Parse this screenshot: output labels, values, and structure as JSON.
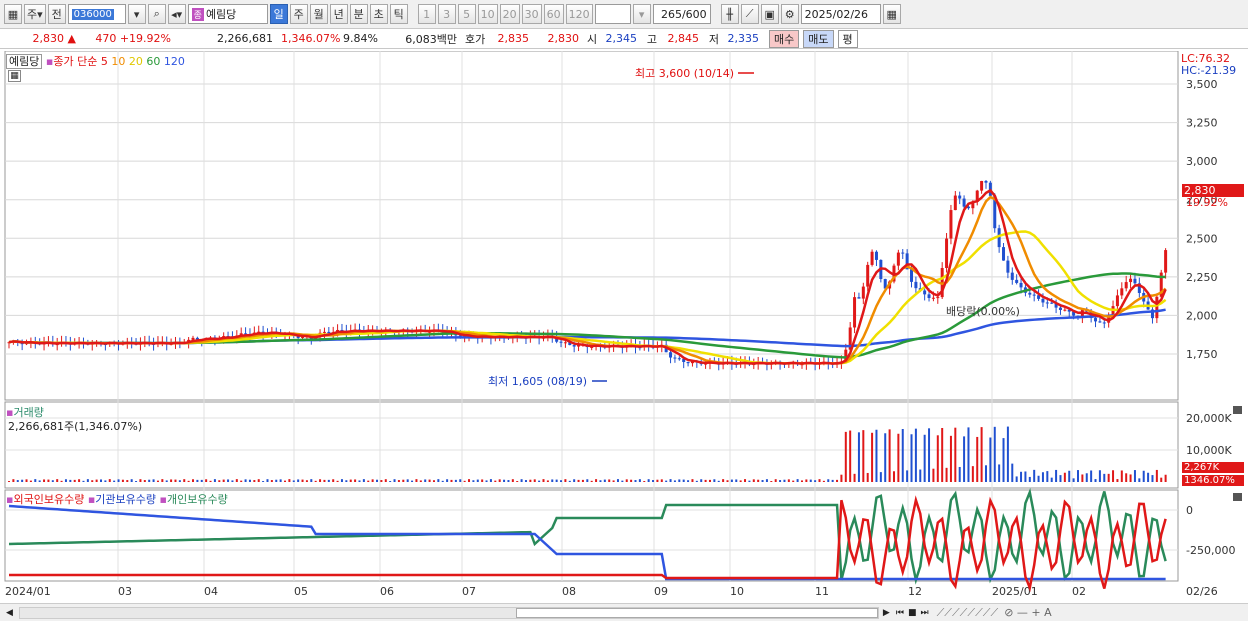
{
  "toolbar": {
    "market": "주",
    "prev": "전",
    "code": "036000",
    "stock_name": "예림당",
    "stock_badge": "종",
    "periods": [
      "일",
      "주",
      "월",
      "년",
      "분",
      "초",
      "틱"
    ],
    "intervals": [
      "1",
      "3",
      "5",
      "10",
      "20",
      "30",
      "60",
      "120"
    ],
    "count": "265",
    "count_total": "/600",
    "date": "2025/02/26"
  },
  "quote": {
    "price": "2,830",
    "arrow": "▲",
    "change": "470",
    "change_pct": "+19.92%",
    "volume": "2,266,681",
    "vol_pct": "1,346.07%",
    "turnover": "9.84%",
    "amount": "6,083백만",
    "ask_label": "호가",
    "ask1": "2,835",
    "ask2": "2,830",
    "open_label": "시",
    "open": "2,345",
    "high_label": "고",
    "high": "2,845",
    "low_label": "저",
    "low": "2,335",
    "buy": "매수",
    "sell": "매도",
    "eval": "평"
  },
  "main_panel": {
    "legend_name": "예림당",
    "legend_series": "종가 단순",
    "ma_periods": [
      "5",
      "10",
      "20",
      "60",
      "120"
    ],
    "lc": "LC:76.32",
    "hc": "HC:-21.39",
    "price_tag": "2,830",
    "pct_tag": "19.92%",
    "high_note": "최고 3,600 (10/14)",
    "low_note": "최저 1,605 (08/19)",
    "dividend_note": "배당락(0.00%)",
    "y_ticks": [
      "3,500",
      "3,250",
      "3,000",
      "2,750",
      "2,500",
      "2,250",
      "2,000",
      "1,750"
    ]
  },
  "volume_panel": {
    "title": "거래량",
    "value": "2,266,681주(1,346.07%)",
    "y_ticks": [
      "20,000K",
      "10,000K"
    ],
    "tag1": "2,267K",
    "tag2": "1346.07%"
  },
  "holder_panel": {
    "series": [
      "외국인보유수량",
      "기관보유수량",
      "개인보유수량"
    ],
    "y_ticks": [
      "0",
      "-250,000"
    ]
  },
  "x_axis": {
    "labels": [
      "2024/01",
      "03",
      "04",
      "05",
      "06",
      "07",
      "08",
      "09",
      "10",
      "11",
      "12",
      "2025/01",
      "02",
      "02/26"
    ]
  },
  "colors": {
    "ma5": "#e01818",
    "ma10": "#f08c00",
    "ma20": "#f0e000",
    "ma60": "#2a9a3a",
    "ma120": "#2f55e0",
    "up": "#e01818",
    "down": "#2050d0"
  }
}
